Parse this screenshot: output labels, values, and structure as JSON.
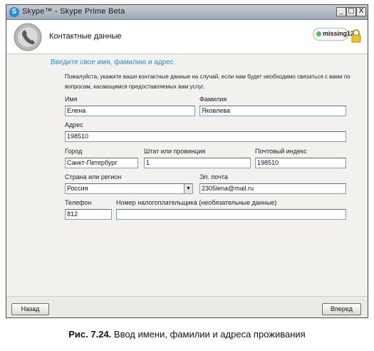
{
  "window": {
    "title": "Skype™ - Skype Prime Beta",
    "controls": {
      "minimize": "_",
      "maximize": "□",
      "close": "X"
    }
  },
  "header": {
    "title": "Контактные данные",
    "user": "missing12",
    "icons": [
      "skype-logo-icon",
      "lock-icon"
    ]
  },
  "form": {
    "section_title": "Введите свое имя, фамилию и адрес",
    "instructions": "Пожалуйста, укажите ваши контактные данные на случай, если нам будет необходимо связаться с вами по вопросам, касающимся предоставляемых вам услуг.",
    "first_name": {
      "label": "Имя",
      "value": "Елена"
    },
    "last_name": {
      "label": "Фамилия",
      "value": "Яковлева"
    },
    "address": {
      "label": "Адрес",
      "value": "198510"
    },
    "city": {
      "label": "Город",
      "value": "Санкт-Петербург"
    },
    "state": {
      "label": "Штат или провинция",
      "value": "1"
    },
    "postal_code": {
      "label": "Почтовый индекс",
      "value": "198510"
    },
    "country": {
      "label": "Страна или регион",
      "value": "Россия"
    },
    "email": {
      "label": "Эл. почта",
      "value": "2305lena@mail.ru"
    },
    "phone": {
      "label": "Телефон",
      "value": "812"
    },
    "tax_id": {
      "label": "Номер налогоплательщика (необязательные данные)",
      "value": ""
    }
  },
  "footer": {
    "back_label": "Назад",
    "next_label": "Вперед"
  },
  "caption": {
    "number": "Рис. 7.24.",
    "text": "Ввод имени, фамилии и адреса проживания"
  },
  "colors": {
    "accent": "#1e8fd8",
    "window_bg": "#f2f1ee",
    "field_border": "#7f9db9"
  }
}
